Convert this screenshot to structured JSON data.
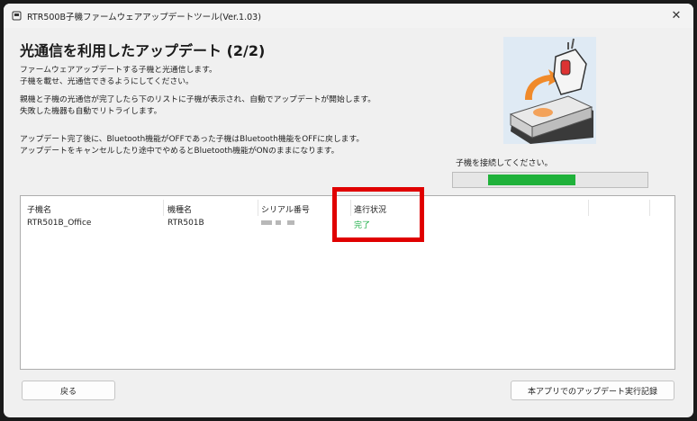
{
  "window": {
    "title": "RTR500B子機ファームウェアアップデートツール(Ver.1.03)",
    "close_glyph": "✕"
  },
  "main": {
    "heading": "光通信を利用したアップデート (2/2)",
    "desc_lines": [
      "ファームウェアアップデートする子機と光通信します。",
      "子機を載せ、光通信できるようにしてください。",
      "親機と子機の光通信が完了したら下のリストに子機が表示され、自動でアップデートが開始します。",
      "失敗した機器も自動でリトライします。",
      "アップデート完了後に、Bluetooth機能がOFFであった子機はBluetooth機能をOFFに戻します。",
      "アップデートをキャンセルしたり途中でやめるとBluetooth機能がONのままになります。"
    ],
    "connect_label": "子機を接続してください。",
    "progress": {
      "start_fraction": 0.18,
      "end_fraction": 0.63
    }
  },
  "list": {
    "columns": [
      "子機名",
      "機種名",
      "シリアル番号",
      "進行状況"
    ],
    "rows": [
      {
        "name": "RTR501B_Office",
        "model": "RTR501B",
        "status": "完了"
      }
    ]
  },
  "buttons": {
    "back": "戻る",
    "history": "本アプリでのアップデート実行記録"
  },
  "colors": {
    "accent_green": "#1fb13a",
    "status_done": "#22b14c",
    "highlight_red": "#e00000"
  },
  "icons": [
    "app-icon",
    "close-icon",
    "device-illustration"
  ]
}
